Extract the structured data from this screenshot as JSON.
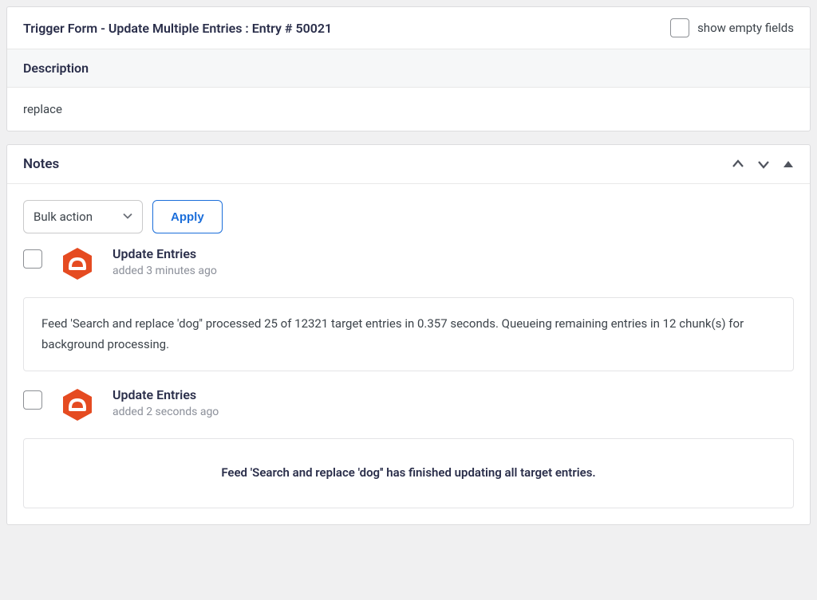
{
  "entry_panel": {
    "title": "Trigger Form - Update Multiple Entries : Entry # 50021",
    "show_empty_label": "show empty fields"
  },
  "description": {
    "header": "Description",
    "value": "replace"
  },
  "notes": {
    "title": "Notes",
    "bulk_action_label": "Bulk action",
    "apply_label": "Apply",
    "items": [
      {
        "icon": "gravity-icon",
        "title": "Update Entries",
        "time": "added 3 minutes ago",
        "body": "Feed 'Search and replace 'dog'' processed 25 of 12321 target entries in 0.357 seconds. Queueing remaining entries in 12 chunk(s) for background processing.",
        "bold": false
      },
      {
        "icon": "gravity-icon",
        "title": "Update Entries",
        "time": "added 2 seconds ago",
        "body": "Feed 'Search and replace 'dog'' has finished updating all target entries.",
        "bold": true
      }
    ]
  }
}
